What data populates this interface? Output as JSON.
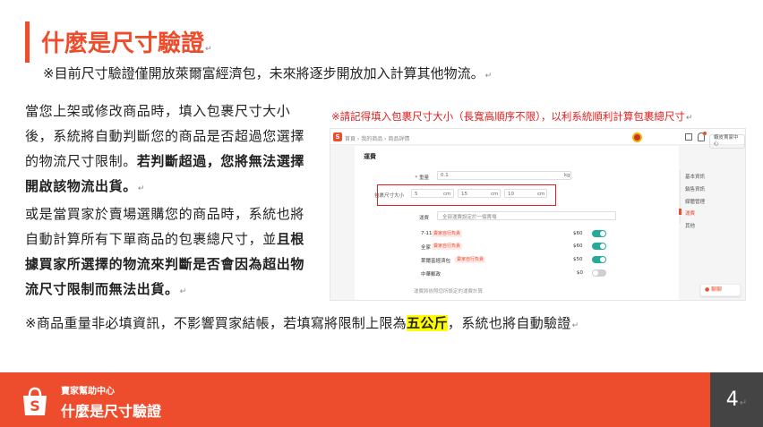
{
  "title": "什麼是尺寸驗證",
  "subtitle": "※目前尺寸驗證僅開放萊爾富經濟包，未來將逐步開放加入計算其他物流。",
  "body": {
    "p1_a": "當您上架或修改商品時，填入包裹尺寸大小後，系統將自動判斷您的商品是否超過您選擇的物流尺寸限制。",
    "p1_b": "若判斷超過，您將無法選擇開啟該物流出貨。",
    "p2_a": "或是當買家於賣場選購您的商品時，系統也將自動計算所有下單商品的包裹總尺寸，並",
    "p2_b": "且根據買家所選擇的物流來判斷是否會因為超出物流尺寸限制而無法出貨。"
  },
  "red_note": "※請記得填入包裹尺寸大小（長寬高順序不限），以利系統順利計算包裹總尺寸",
  "screenshot": {
    "logo": "S",
    "breadcrumb": "首頁 › 我的商品 › 商品詳情",
    "top_pill": "蝦皮賣家中心",
    "heading": "運費",
    "weight_label": "* 重量",
    "weight_value": "0.1",
    "weight_unit": "kg",
    "size_label": "包裹尺寸大小",
    "size_values": [
      "5",
      "15",
      "10"
    ],
    "size_unit": "cm",
    "shipping_label": "運費",
    "shipping_note": "全部運費設定於一個賣場",
    "rows": [
      {
        "name": "7-11",
        "tag": "賣家自行負責",
        "price": "$60",
        "on": true
      },
      {
        "name": "全家",
        "tag": "賣家自行負責",
        "price": "$60",
        "on": true
      },
      {
        "name": "萊爾富經濟包",
        "tag": "賣家自行負責",
        "price": "$50",
        "on": true
      },
      {
        "name": "中華郵政",
        "tag": "",
        "price": "$0",
        "on": false
      }
    ],
    "footer_note": "運費將依照您所設定的運費計算",
    "nav": [
      "基本資訊",
      "銷售資訊",
      "媒體管理",
      "運費",
      "其他"
    ],
    "chat_label": "聊聊"
  },
  "footnote_a": "※商品重量非必填資訊，不影響買家結帳，若填寫將限制上限為",
  "footnote_hl": "五公斤",
  "footnote_b": "，系統也將自動驗證",
  "footer": {
    "small": "賣家幫助中心",
    "title": "什麼是尺寸驗證",
    "page": "4"
  },
  "colors": {
    "brand": "#ee4d2d",
    "note": "#e02020",
    "highlight": "#ffff00",
    "page_box": "#444444"
  }
}
